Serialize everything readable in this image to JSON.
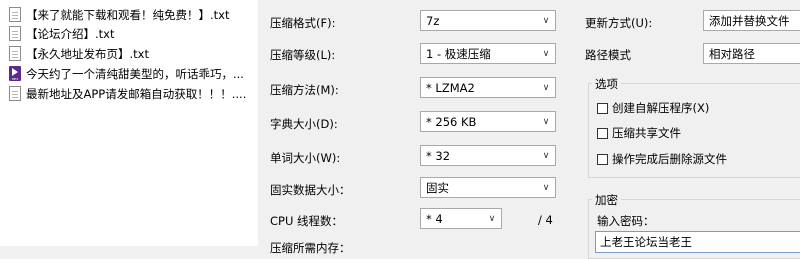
{
  "file_list": [
    {
      "name": "【来了就能下载和观看！纯免费！】.txt",
      "type": "txt"
    },
    {
      "name": "【论坛介绍】.txt",
      "type": "txt"
    },
    {
      "name": "【永久地址发布页】.txt",
      "type": "txt"
    },
    {
      "name": "今天约了一个清纯甜美型的，听话乖巧，...",
      "type": "mp4"
    },
    {
      "name": "最新地址及APP请发邮箱自动获取！！！....",
      "type": "txt"
    }
  ],
  "archive_format": {
    "label": "压缩格式(F):",
    "value": "7z"
  },
  "compression_level": {
    "label": "压缩等级(L):",
    "value": "1 - 极速压缩"
  },
  "compression_method": {
    "label": "压缩方法(M):",
    "value": "* LZMA2"
  },
  "dictionary_size": {
    "label": "字典大小(D):",
    "value": "* 256 KB"
  },
  "word_size": {
    "label": "单词大小(W):",
    "value": "* 32"
  },
  "solid_block": {
    "label": "固实数据大小：",
    "value": "固实"
  },
  "cpu_threads": {
    "label": "CPU 线程数：",
    "value": "* 4",
    "total": "/ 4"
  },
  "memory_usage": {
    "label": "压缩所需内存："
  },
  "update_mode": {
    "label": "更新方式(U):",
    "value": "添加并替换文件"
  },
  "path_mode": {
    "label": "路径模式",
    "value": "相对路径"
  },
  "options": {
    "title": "选项",
    "create_sfx": "创建自解压程序(X)",
    "compress_shared": "压缩共享文件",
    "delete_after": "操作完成后删除源文件"
  },
  "encryption": {
    "title": "加密",
    "password_label": "输入密码：",
    "password_value": "上老王论坛当老王"
  },
  "colors": {
    "dialog_bg": "#f0f0f0",
    "list_bg": "#ffffff",
    "accent_border": "#7a9cc8"
  }
}
